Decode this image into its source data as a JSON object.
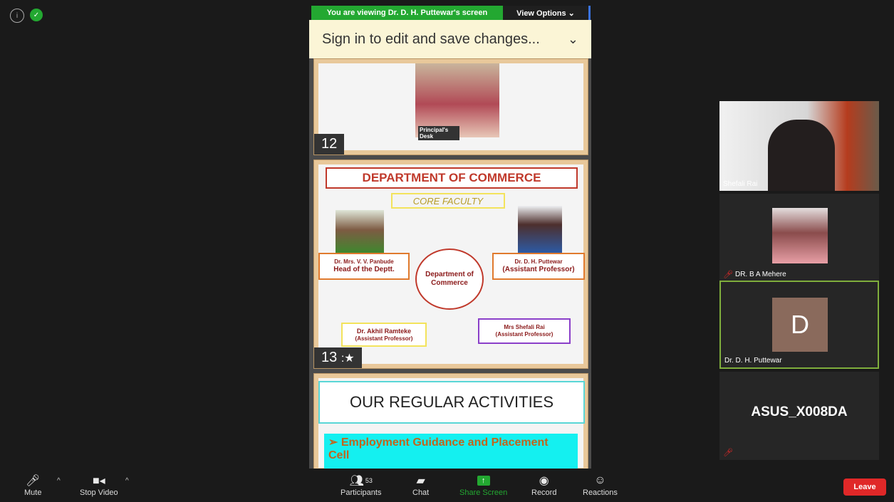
{
  "banner": {
    "viewing": "You are viewing Dr. D. H. Puttewar's screen",
    "view_options": "View Options ⌄"
  },
  "signin": {
    "text": "Sign in to edit and save changes...",
    "chevron": "⌄"
  },
  "slide12": {
    "number": "12",
    "caption_left": "Principal's Desk"
  },
  "slide13": {
    "number": "13",
    "title": "DEPARTMENT OF COMMERCE",
    "subtitle": "CORE FACULTY",
    "center": "Department of Commerce",
    "head_name": "Dr. Mrs. V. V. Panbude",
    "head_role": "Head of the Deptt.",
    "p1_name": "Dr. D. H. Puttewar",
    "p1_role": "(Assistant Professor)",
    "p2_name": "Dr. Akhil Ramteke",
    "p2_role": "(Assistant Professor)",
    "p3_name": "Mrs Shefali Rai",
    "p3_role": "(Assistant Professor)"
  },
  "slide14": {
    "title": "OUR REGULAR ACTIVITIES",
    "item1": "Employment Guidance and Placement",
    "item1b": "Cell"
  },
  "participants": [
    {
      "name": "Shefali Rai"
    },
    {
      "name": "DR. B A Mehere"
    },
    {
      "name": "Dr. D. H. Puttewar",
      "initial": "D"
    },
    {
      "name": "ASUS_X008DA"
    }
  ],
  "toolbar": {
    "mute": "Mute",
    "stop_video": "Stop Video",
    "participants": "Participants",
    "participants_count": "53",
    "chat": "Chat",
    "share_screen": "Share Screen",
    "record": "Record",
    "reactions": "Reactions",
    "leave": "Leave"
  },
  "colors": {
    "share_green": "#23a831",
    "leave_red": "#e02828",
    "active_speaker": "#7fae3c"
  }
}
